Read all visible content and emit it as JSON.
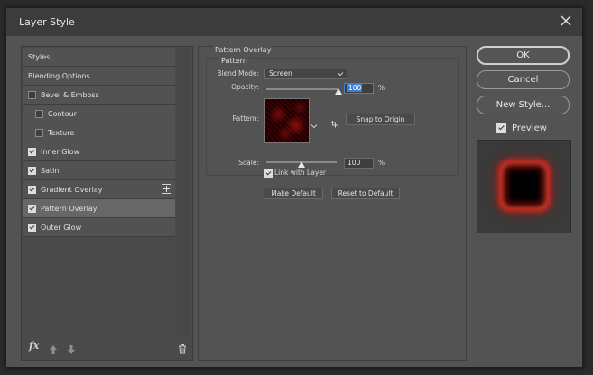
{
  "window": {
    "title": "Layer Style"
  },
  "styles_list": [
    {
      "label": "Styles",
      "checkbox": false,
      "checked": false,
      "indent": false,
      "selected": false
    },
    {
      "label": "Blending Options",
      "checkbox": false,
      "checked": false,
      "indent": false,
      "selected": false
    },
    {
      "label": "Bevel & Emboss",
      "checkbox": true,
      "checked": false,
      "indent": false,
      "selected": false
    },
    {
      "label": "Contour",
      "checkbox": true,
      "checked": false,
      "indent": true,
      "selected": false
    },
    {
      "label": "Texture",
      "checkbox": true,
      "checked": false,
      "indent": true,
      "selected": false
    },
    {
      "label": "Inner Glow",
      "checkbox": true,
      "checked": true,
      "indent": false,
      "selected": false
    },
    {
      "label": "Satin",
      "checkbox": true,
      "checked": true,
      "indent": false,
      "selected": false
    },
    {
      "label": "Gradient Overlay",
      "checkbox": true,
      "checked": true,
      "indent": false,
      "selected": false,
      "add_button": true
    },
    {
      "label": "Pattern Overlay",
      "checkbox": true,
      "checked": true,
      "indent": false,
      "selected": true
    },
    {
      "label": "Outer Glow",
      "checkbox": true,
      "checked": true,
      "indent": false,
      "selected": false
    }
  ],
  "footer": {
    "fx_label": "fx"
  },
  "pattern_overlay": {
    "group_title": "Pattern Overlay",
    "subgroup_title": "Pattern",
    "blend_mode_label": "Blend Mode:",
    "blend_mode_value": "Screen",
    "opacity_label": "Opacity:",
    "opacity_value": "100",
    "opacity_unit": "%",
    "opacity_level": 1.0,
    "pattern_label": "Pattern:",
    "snap_button": "Snap to Origin",
    "scale_label": "Scale:",
    "scale_value": "100",
    "scale_unit": "%",
    "scale_level": 0.5,
    "link_label": "Link with Layer",
    "link_checked": true,
    "make_default_button": "Make Default",
    "reset_default_button": "Reset to Default"
  },
  "right_buttons": {
    "ok": "OK",
    "cancel": "Cancel",
    "new_style": "New Style..."
  },
  "preview": {
    "label": "Preview",
    "checked": true
  },
  "colors": {
    "accent": "#3d7fd6",
    "dialog_bg": "#535353",
    "glow": "#e6281e"
  }
}
